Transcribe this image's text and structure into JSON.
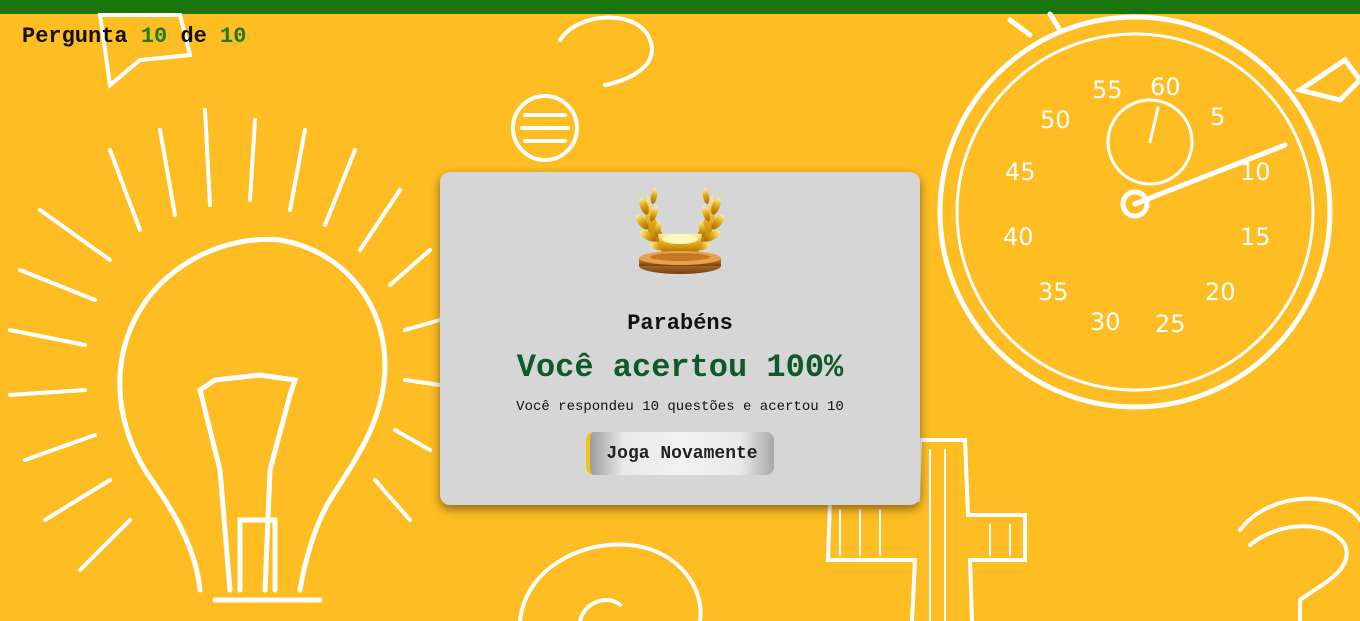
{
  "header": {
    "counter_prefix": "Pergunta",
    "current": "10",
    "separator": "de",
    "total": "10"
  },
  "result": {
    "trophy_icon": "laurel-trophy-icon",
    "title": "Parabéns",
    "score_text": "Você acertou 100%",
    "summary": "Você respondeu 10 questões e acertou 10",
    "play_again_label": "Joga Novamente"
  },
  "colors": {
    "background": "#fdbd23",
    "top_bar": "#1a760b",
    "counter_number": "#1f7a14",
    "score_text": "#0f5a2a",
    "modal_background": "#d6d6d6",
    "button_accent": "#f0c419"
  }
}
